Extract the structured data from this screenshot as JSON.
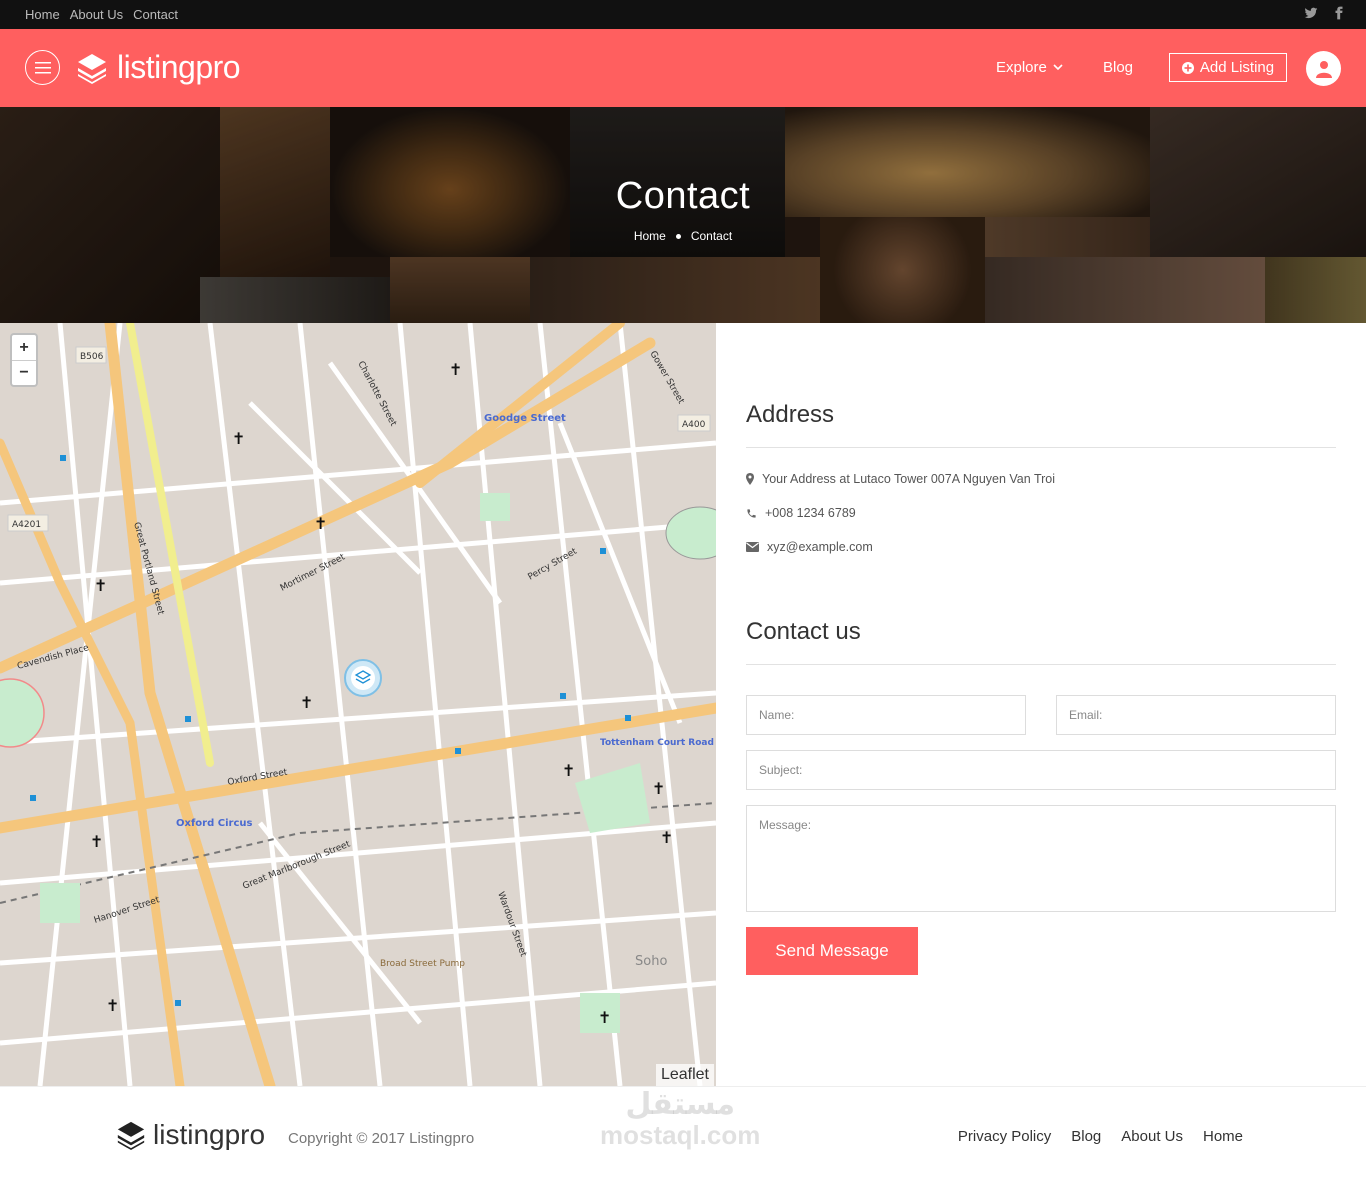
{
  "topbar": {
    "links": [
      "Home",
      "About Us",
      "Contact"
    ],
    "social": [
      "twitter-icon",
      "facebook-icon"
    ]
  },
  "header": {
    "brand": "listingpro",
    "nav": {
      "explore": "Explore",
      "blog": "Blog",
      "add_listing": "Add Listing"
    },
    "accent": "#ff5f5f"
  },
  "hero": {
    "title": "Contact",
    "breadcrumb": [
      "Home",
      "Contact"
    ]
  },
  "map": {
    "attribution": "Leaflet",
    "zoom_in": "+",
    "zoom_out": "−",
    "labels": [
      "B506",
      "A400",
      "A4201",
      "Goodge Street",
      "Oxford Circus",
      "Tottenham Court Road",
      "Soho",
      "Broad Street Pump",
      "Mortimer Street",
      "Oxford Street",
      "Great Portland Street",
      "Cavendish Place",
      "Charlotte Street",
      "Great Marlborough Street",
      "Wardour Street",
      "Hanover Street",
      "Percy Street",
      "Gower Street"
    ]
  },
  "address": {
    "heading": "Address",
    "location": "Your Address at Lutaco Tower 007A Nguyen Van Troi",
    "phone": "+008 1234 6789",
    "email": "xyz@example.com"
  },
  "contact": {
    "heading": "Contact us",
    "name_placeholder": "Name:",
    "email_placeholder": "Email:",
    "subject_placeholder": "Subject:",
    "message_placeholder": "Message:",
    "send": "Send Message"
  },
  "footer": {
    "brand": "listingpro",
    "copyright": "Copyright © 2017 Listingpro",
    "links": [
      "Privacy Policy",
      "Blog",
      "About Us",
      "Home"
    ]
  },
  "watermark": {
    "arabic": "مستقل",
    "latin": "mostaql.com"
  }
}
